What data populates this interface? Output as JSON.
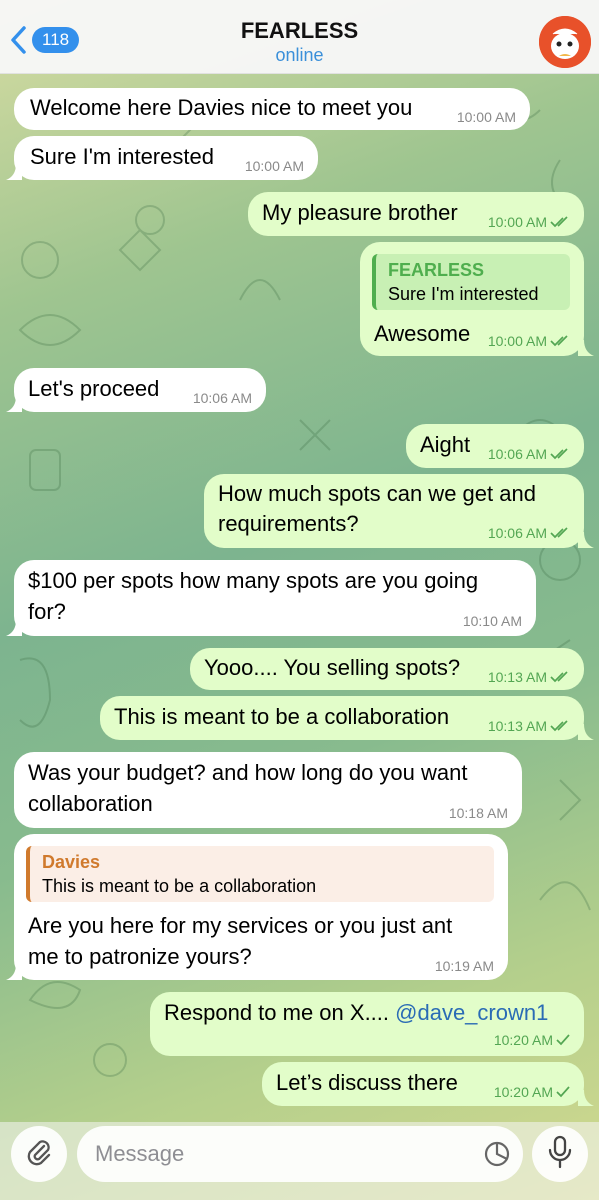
{
  "header": {
    "unread_count": "118",
    "title": "FEARLESS",
    "status": "online"
  },
  "messages": [
    {
      "direction": "in",
      "text": "Welcome here Davies nice to meet you",
      "time": "10:00 AM"
    },
    {
      "direction": "in",
      "text": "Sure I'm interested",
      "time": "10:00 AM"
    },
    {
      "direction": "out",
      "text": "My pleasure brother",
      "time": "10:00 AM",
      "status": "read"
    },
    {
      "direction": "out",
      "reply_to": {
        "name": "FEARLESS",
        "text": "Sure I'm interested"
      },
      "text": "Awesome",
      "time": "10:00 AM",
      "status": "read"
    },
    {
      "direction": "in",
      "text": "Let's proceed",
      "time": "10:06 AM"
    },
    {
      "direction": "out",
      "text": "Aight",
      "time": "10:06 AM",
      "status": "read"
    },
    {
      "direction": "out",
      "lines": [
        "How much spots can we get and",
        "requirements?"
      ],
      "time": "10:06 AM",
      "status": "read"
    },
    {
      "direction": "in",
      "lines": [
        "$100 per spots how many spots are you going",
        "for?"
      ],
      "time": "10:10 AM"
    },
    {
      "direction": "out",
      "text": "Yooo.... You selling spots?",
      "time": "10:13 AM",
      "status": "read"
    },
    {
      "direction": "out",
      "text": "This is meant to be a collaboration",
      "time": "10:13 AM",
      "status": "read"
    },
    {
      "direction": "in",
      "lines": [
        "Was your budget? and how long do you want",
        "collaboration"
      ],
      "time": "10:18 AM"
    },
    {
      "direction": "in",
      "reply_to": {
        "name": "Davies",
        "text": "This is meant to be a collaboration"
      },
      "lines": [
        "Are you here for my services or you just ant",
        "me to patronize yours?"
      ],
      "time": "10:19 AM"
    },
    {
      "direction": "out",
      "text_prefix": "Respond to me on X.... ",
      "mention": "@dave_crown1",
      "time": "10:20 AM",
      "status": "sent"
    },
    {
      "direction": "out",
      "text": "Let’s discuss there",
      "time": "10:20 AM",
      "status": "sent"
    }
  ],
  "composer": {
    "placeholder": "Message"
  },
  "icons": {
    "back": "chevron-left-icon",
    "attach": "paperclip-icon",
    "sticker": "sticker-icon",
    "mic": "microphone-icon"
  },
  "colors": {
    "accent": "#3390ec",
    "outgoing_bubble": "#e2fdc9",
    "incoming_bubble": "#ffffff",
    "read_tick": "#53a653",
    "reply_name_out": "#4fae4e",
    "reply_name_in": "#d07a2d"
  }
}
